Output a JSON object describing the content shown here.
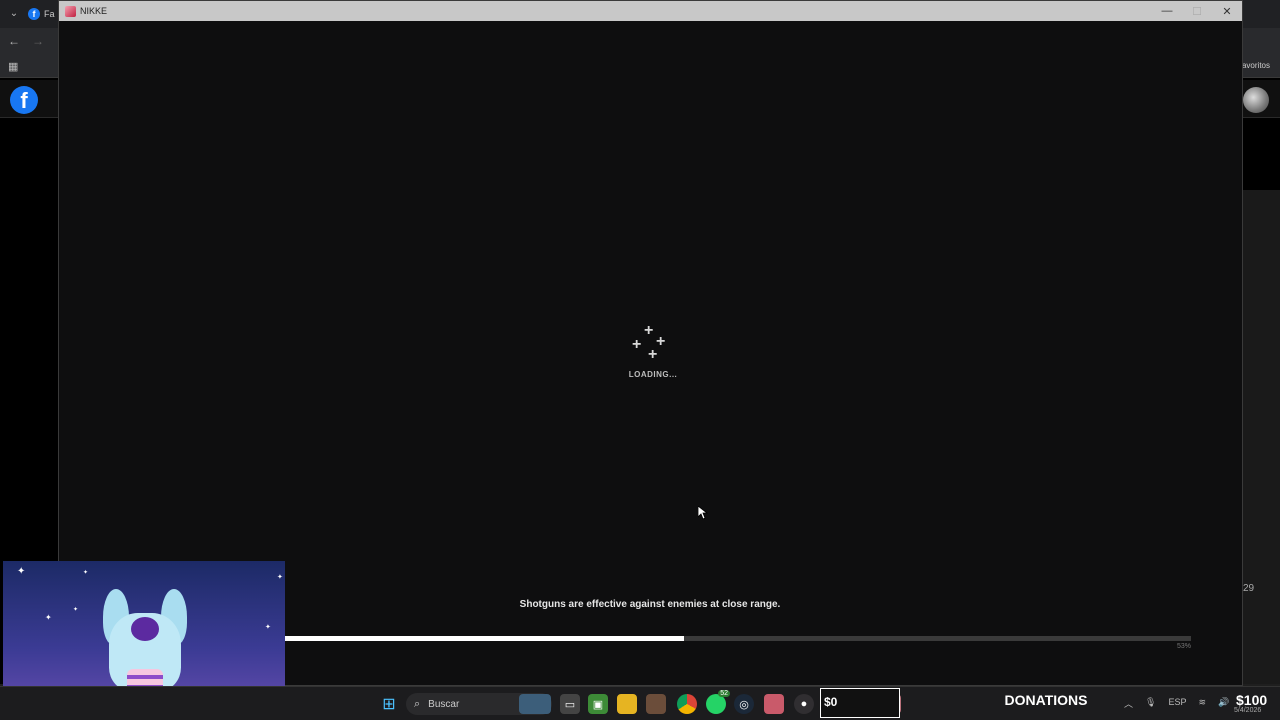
{
  "background_browser": {
    "tab_label": "Fa",
    "bookmarks_right": "avoritos",
    "side_number": "29"
  },
  "game_window": {
    "title": "NIKKE",
    "controls": {
      "minimize": "—",
      "maximize": "☐",
      "close": "✕"
    },
    "loading_text": "LOADING...",
    "tip": "Shotguns are effective against enemies at close range.",
    "progress": {
      "value_percent": 44,
      "label": "53%"
    }
  },
  "taskbar": {
    "search_label": "Buscar",
    "whatsapp_badge": "52",
    "donation_current": "$0",
    "donations_label": "DONATIONS",
    "donation_goal": "$100",
    "language": "ESP",
    "date": "5/4/2026"
  },
  "icons": [
    "facebook-icon",
    "windows-start-icon",
    "search-icon",
    "minecraft-icon",
    "folder-icon",
    "chrome-icon",
    "whatsapp-icon",
    "steam-icon",
    "obs-icon"
  ]
}
